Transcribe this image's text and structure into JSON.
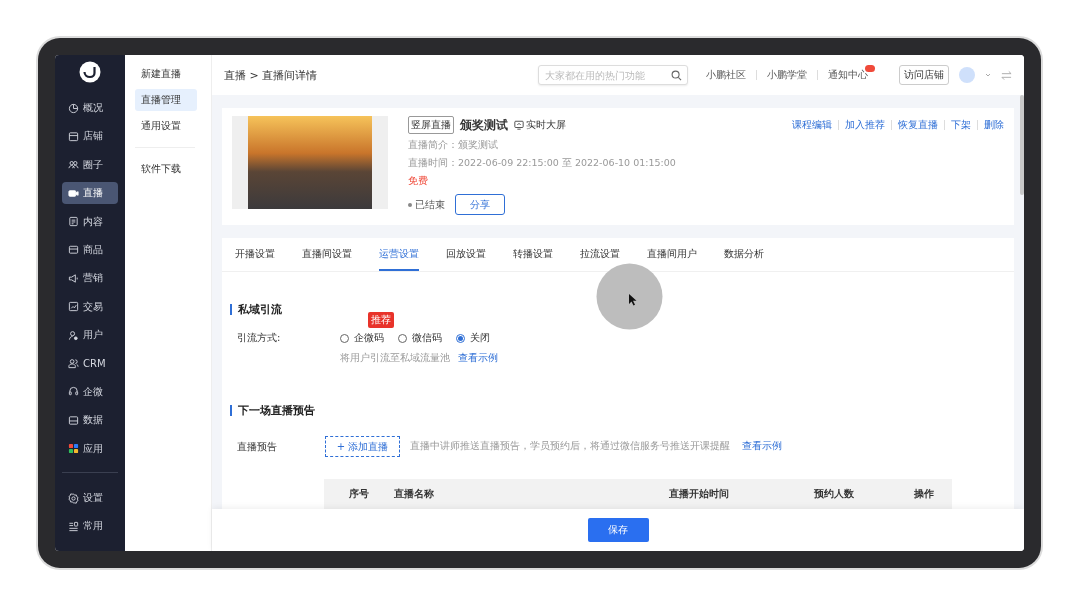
{
  "sidebar": {
    "items": [
      {
        "label": "概况",
        "selected": false
      },
      {
        "label": "店铺",
        "selected": false
      },
      {
        "label": "圈子",
        "selected": false
      },
      {
        "label": "直播",
        "selected": true
      },
      {
        "label": "内容",
        "selected": false
      },
      {
        "label": "商品",
        "selected": false
      },
      {
        "label": "营销",
        "selected": false
      },
      {
        "label": "交易",
        "selected": false
      },
      {
        "label": "用户",
        "selected": false
      },
      {
        "label": "CRM",
        "selected": false
      },
      {
        "label": "企微",
        "selected": false
      },
      {
        "label": "数据",
        "selected": false
      },
      {
        "label": "应用",
        "selected": false
      }
    ],
    "bottom_items": [
      {
        "label": "设置",
        "selected": false
      },
      {
        "label": "常用",
        "selected": false
      }
    ]
  },
  "subnav": {
    "items": [
      {
        "label": "新建直播",
        "selected": false
      },
      {
        "label": "直播管理",
        "selected": true
      },
      {
        "label": "通用设置",
        "selected": false
      }
    ],
    "extra_items": [
      {
        "label": "软件下载",
        "selected": false
      }
    ]
  },
  "header": {
    "breadcrumb": "直播 > 直播间详情",
    "search": {
      "placeholder": "大家都在用的热门功能"
    },
    "links": [
      "小鹏社区",
      "小鹏学堂",
      "通知中心"
    ],
    "visit_button": "访问店铺"
  },
  "live": {
    "tag": "竖屏直播",
    "title": "颁奖测试",
    "screen_link": "实时大屏",
    "intro": "直播简介：颁奖测试",
    "time": "直播时间：2022-06-09 22:15:00 至 2022-06-10 01:15:00",
    "price": "免费",
    "status": "已结束",
    "share_button": "分享",
    "actions": [
      "课程编辑",
      "加入推荐",
      "恢复直播",
      "下架",
      "删除"
    ]
  },
  "tabs": [
    {
      "label": "开播设置",
      "selected": false
    },
    {
      "label": "直播间设置",
      "selected": false
    },
    {
      "label": "运营设置",
      "selected": true
    },
    {
      "label": "回放设置",
      "selected": false
    },
    {
      "label": "转播设置",
      "selected": false
    },
    {
      "label": "拉流设置",
      "selected": false
    },
    {
      "label": "直播间用户",
      "selected": false
    },
    {
      "label": "数据分析",
      "selected": false
    }
  ],
  "private_traffic": {
    "title": "私域引流",
    "field_label": "引流方式:",
    "options": [
      {
        "label": "企微码",
        "selected": false,
        "badge": "推荐"
      },
      {
        "label": "微信码",
        "selected": false
      },
      {
        "label": "关闭",
        "selected": true
      }
    ],
    "hint": "将用户引流至私域流量池",
    "example_link": "查看示例"
  },
  "next_preview": {
    "title": "下一场直播预告",
    "field_label": "直播预告",
    "add_button": "+ 添加直播",
    "hint": "直播中讲师推送直播预告，学员预约后，将通过微信服务号推送开课提醒",
    "example_link": "查看示例",
    "table": {
      "columns": [
        "序号",
        "直播名称",
        "直播开始时间",
        "预约人数",
        "操作"
      ]
    }
  },
  "save_button": "保存"
}
